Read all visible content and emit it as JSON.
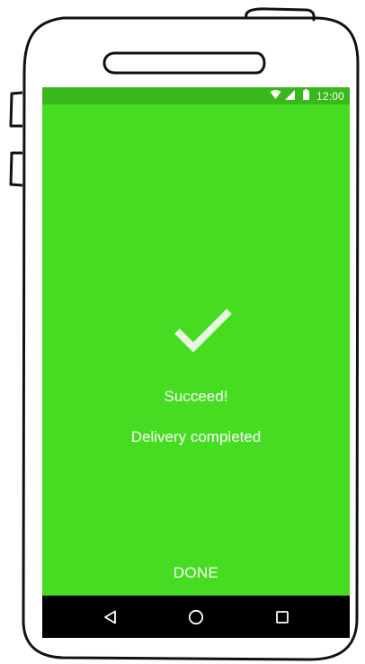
{
  "status_bar": {
    "time": "12:00",
    "icons": [
      "wifi-icon",
      "signal-icon",
      "battery-icon"
    ]
  },
  "content": {
    "icon": "checkmark-icon",
    "title": "Succeed!",
    "subtitle": "Delivery completed"
  },
  "actions": {
    "done_label": "DONE"
  },
  "nav_bar": {
    "buttons": [
      "back-icon",
      "home-icon",
      "recents-icon"
    ]
  },
  "colors": {
    "background": "#46dc22",
    "status_bar": "#38b81a",
    "nav_bar": "#000000",
    "check": "#e8f7df",
    "text": "#ffffff"
  }
}
